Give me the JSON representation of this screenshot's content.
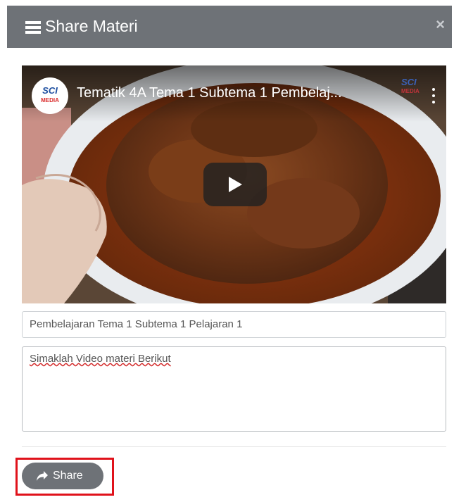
{
  "modal": {
    "title": "Share Materi",
    "close_label": "×",
    "colors": {
      "header": "#6e7277",
      "button": "#6e7277",
      "highlight": "#e0121b"
    }
  },
  "video": {
    "title": "Tematik 4A Tema 1 Subtema 1 Pembelaj...",
    "channel_logo": {
      "line1": "SCI",
      "line2": "MEDIA"
    },
    "watermark": {
      "line1": "SCI",
      "line2": "MEDIA"
    },
    "icons": {
      "play": "play-icon",
      "more": "more-vert-icon"
    }
  },
  "form": {
    "title_value": "Pembelajaran Tema 1 Subtema 1 Pelajaran 1",
    "description_value": "Simaklah Video materi Berikut"
  },
  "actions": {
    "share_label": "Share",
    "share_icon": "share-arrow-icon"
  }
}
